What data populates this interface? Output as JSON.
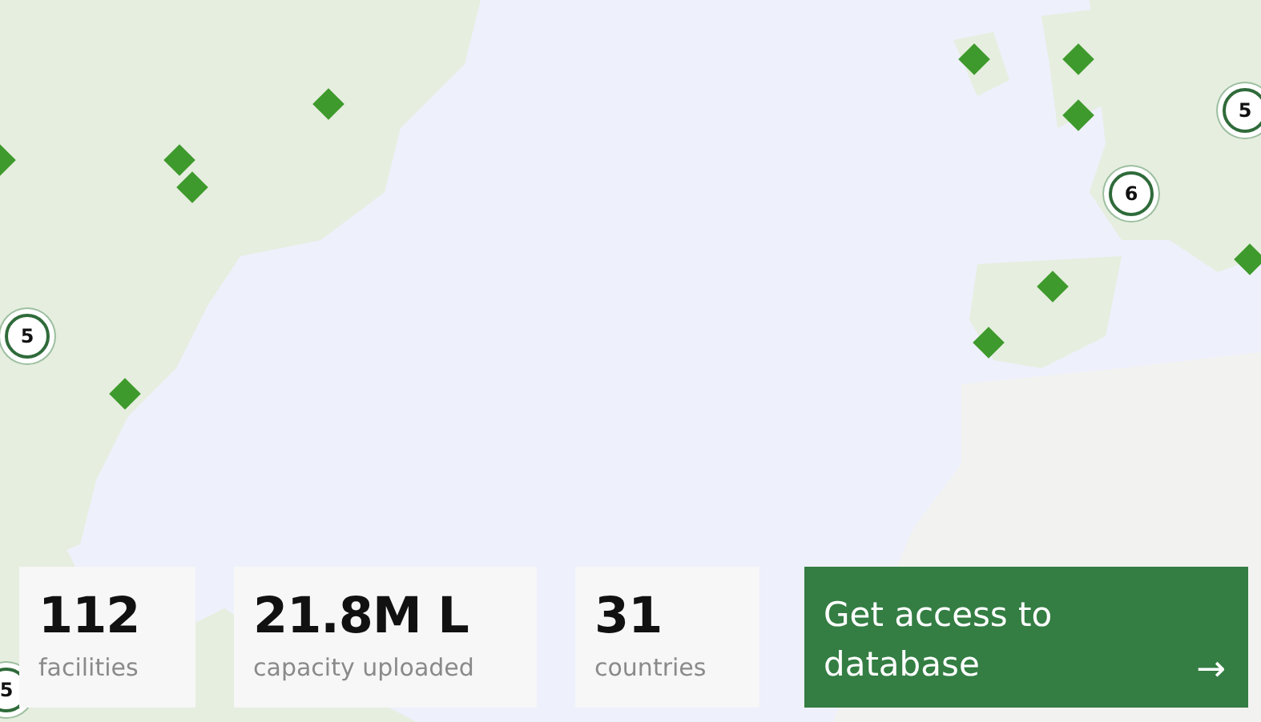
{
  "map": {
    "markers": [
      {
        "kind": "pin"
      },
      {
        "kind": "pin"
      },
      {
        "kind": "pin"
      },
      {
        "kind": "pin"
      },
      {
        "kind": "pin"
      },
      {
        "kind": "pin"
      },
      {
        "kind": "pin"
      },
      {
        "kind": "pin"
      },
      {
        "kind": "pin"
      },
      {
        "kind": "pin"
      },
      {
        "kind": "pin"
      },
      {
        "kind": "cluster",
        "count": "5"
      },
      {
        "kind": "cluster",
        "count": "6"
      },
      {
        "kind": "cluster",
        "count": "5"
      },
      {
        "kind": "cluster",
        "count": "5"
      }
    ]
  },
  "stats": [
    {
      "value": "112",
      "label": "facilities"
    },
    {
      "value": "21.8M L",
      "label": "capacity uploaded"
    },
    {
      "value": "31",
      "label": "countries"
    }
  ],
  "cta": {
    "label": "Get access to database",
    "arrow": "→"
  }
}
